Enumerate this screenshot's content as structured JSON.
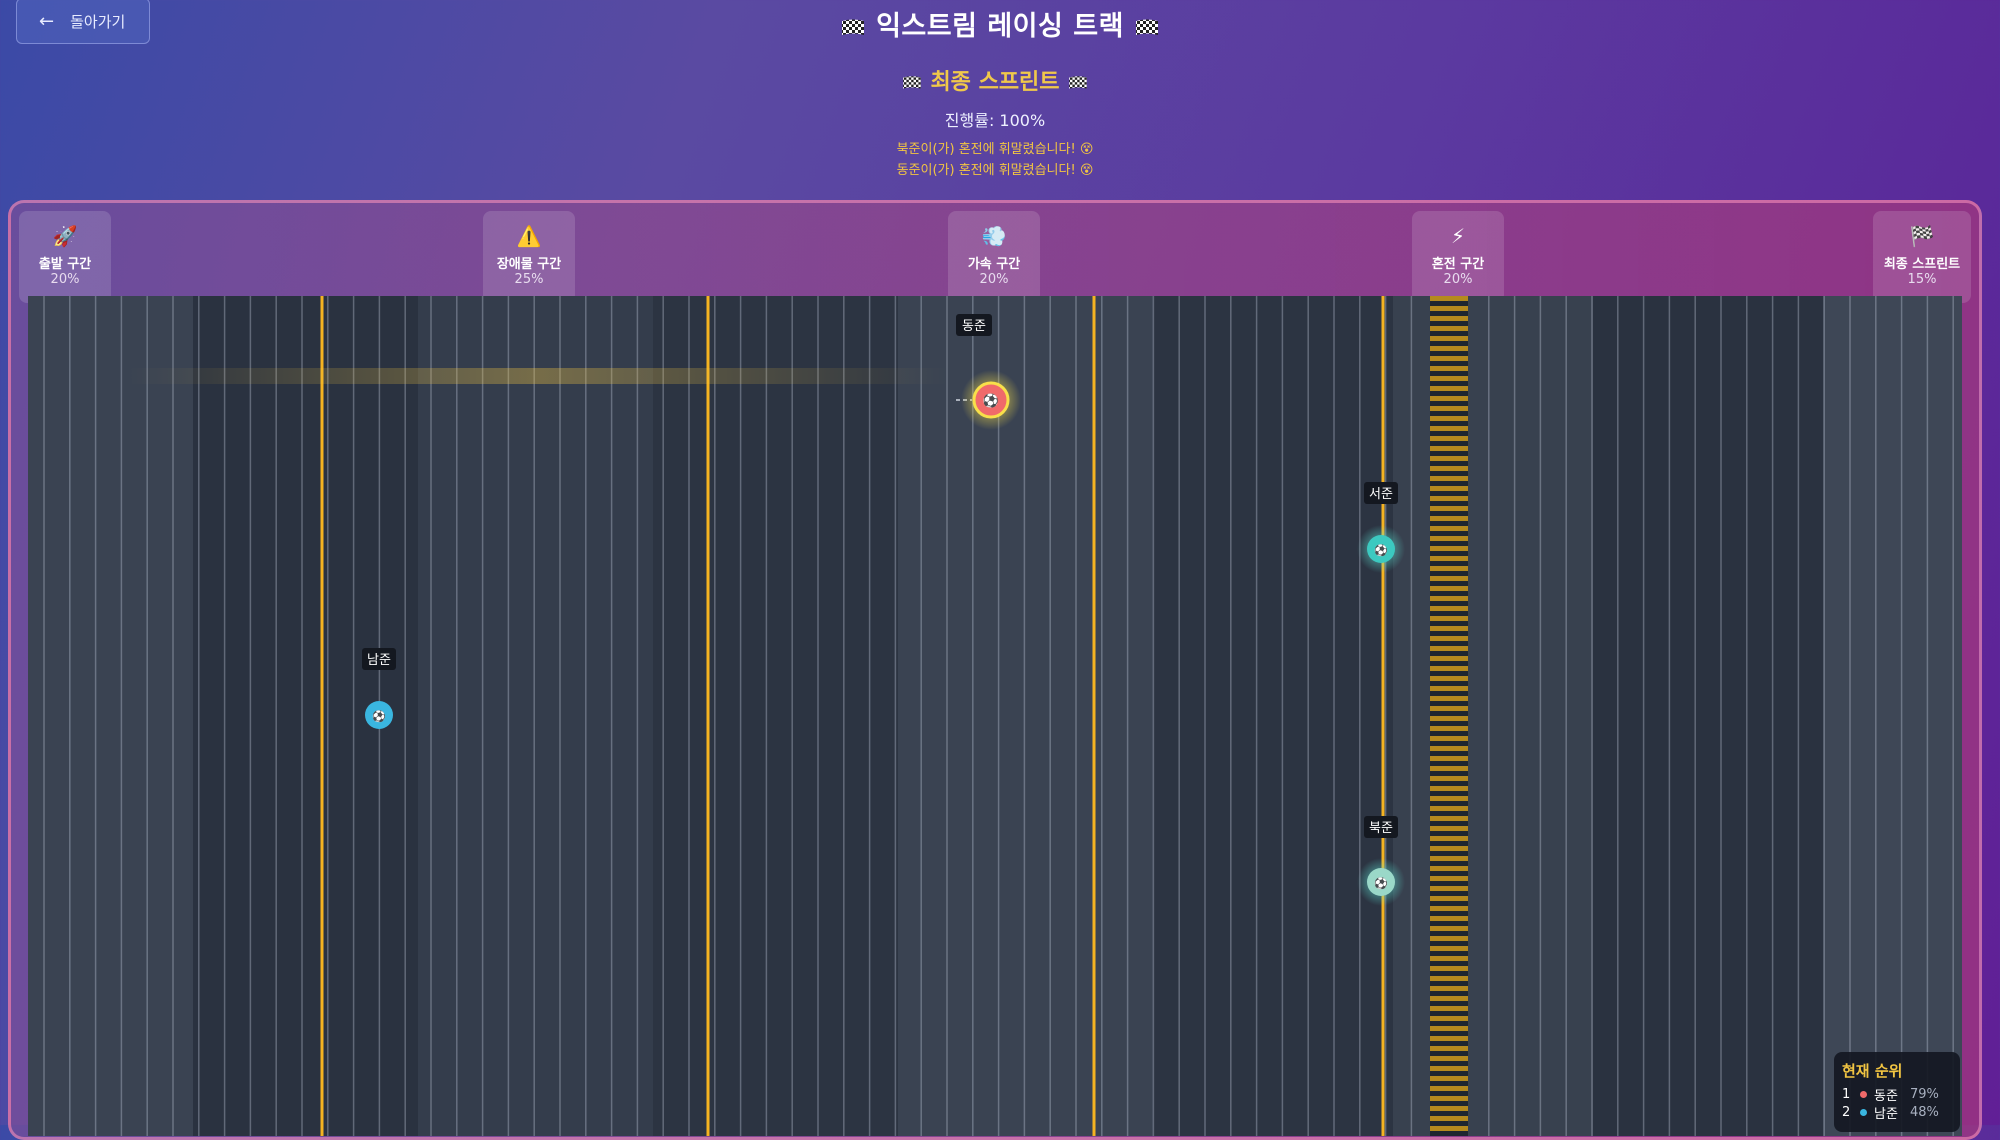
{
  "header": {
    "back_label": "돌아가기",
    "back_icon": "arrow-left-icon",
    "title": "익스트림 레이싱 트랙",
    "stage_title": "최종 스프린트",
    "progress_text": "진행률: 100%",
    "messages": [
      "북준이(가) 혼전에 휘말렸습니다! 😵",
      "동준이(가) 혼전에 휘말렸습니다! 😵"
    ]
  },
  "zones": [
    {
      "name": "출발 구간",
      "percent": "20%",
      "icon": "rocket-icon"
    },
    {
      "name": "장애물 구간",
      "percent": "25%",
      "icon": "warning-icon"
    },
    {
      "name": "가속 구간",
      "percent": "20%",
      "icon": "wind-icon"
    },
    {
      "name": "혼전 구간",
      "percent": "20%",
      "icon": "lightning-icon"
    },
    {
      "name": "최종 스프린트",
      "percent": "15%",
      "icon": "checkered-flag-icon"
    }
  ],
  "racers": [
    {
      "name": "동준",
      "color": "#f06a6a",
      "highlight": true
    },
    {
      "name": "서준",
      "color": "#3cc9c0"
    },
    {
      "name": "남준",
      "color": "#3ab6e0"
    },
    {
      "name": "북준",
      "color": "#9ad8c8"
    }
  ],
  "leaderboard": {
    "title": "현재 순위",
    "rows": [
      {
        "rank": "1",
        "name": "동준",
        "percent": "79%",
        "color": "#f06a6a"
      },
      {
        "rank": "2",
        "name": "남준",
        "percent": "48%",
        "color": "#3ab6e0"
      }
    ]
  },
  "colors": {
    "accent": "#f2c542",
    "track_bg": "#2f3746",
    "divider": "#f5b321"
  }
}
